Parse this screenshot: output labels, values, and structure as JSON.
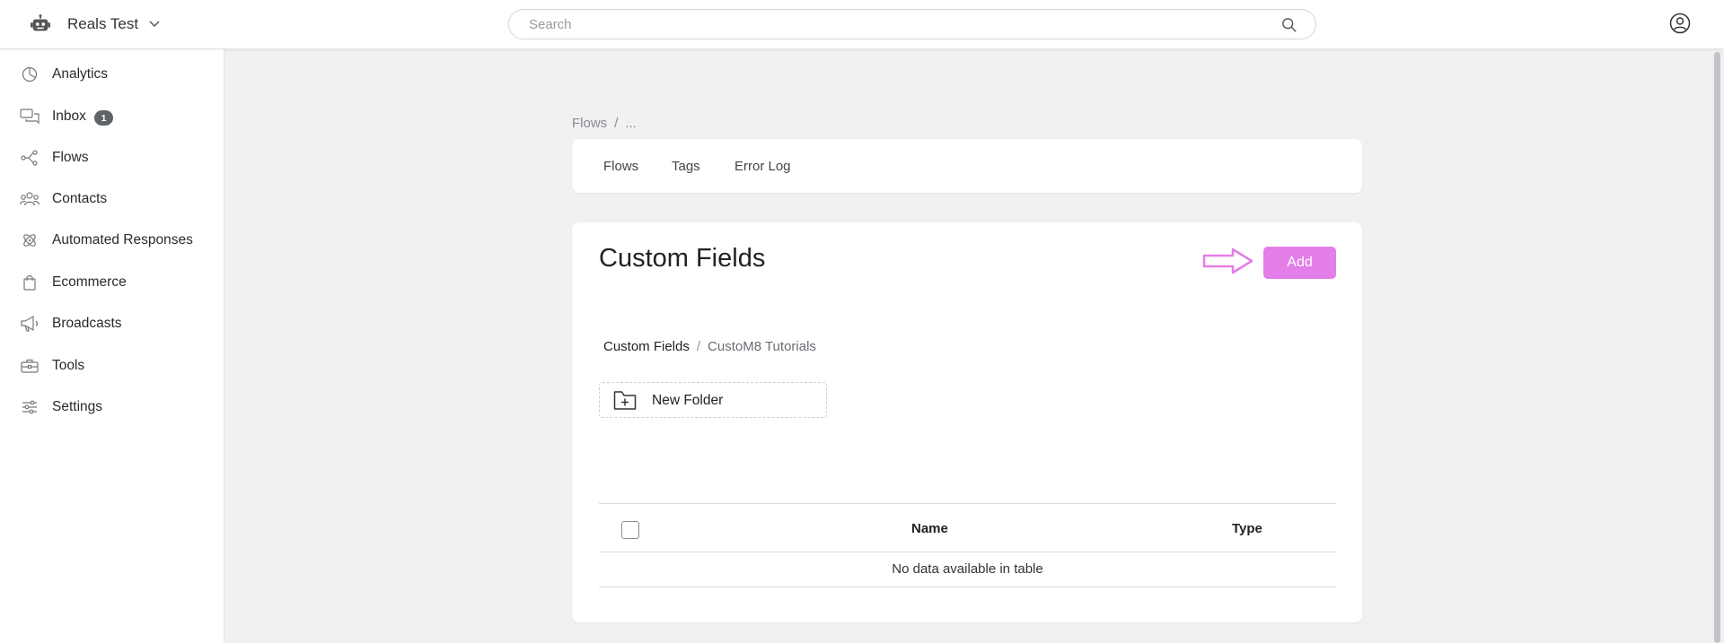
{
  "header": {
    "workspace_name": "Reals Test",
    "search_placeholder": "Search"
  },
  "sidebar": {
    "items": [
      {
        "label": "Analytics",
        "icon": "analytics-icon"
      },
      {
        "label": "Inbox",
        "icon": "inbox-icon",
        "badge": "1"
      },
      {
        "label": "Flows",
        "icon": "flows-icon"
      },
      {
        "label": "Contacts",
        "icon": "contacts-icon"
      },
      {
        "label": "Automated Responses",
        "icon": "automated-responses-icon"
      },
      {
        "label": "Ecommerce",
        "icon": "ecommerce-icon"
      },
      {
        "label": "Broadcasts",
        "icon": "broadcasts-icon"
      },
      {
        "label": "Tools",
        "icon": "tools-icon"
      },
      {
        "label": "Settings",
        "icon": "settings-icon"
      }
    ]
  },
  "breadcrumb": {
    "root": "Flows",
    "separator": "/",
    "current": "..."
  },
  "tabs": [
    {
      "label": "Flows"
    },
    {
      "label": "Tags"
    },
    {
      "label": "Error Log"
    }
  ],
  "panel": {
    "title": "Custom Fields",
    "add_label": "Add",
    "accent_color": "#e47ee8"
  },
  "folder_breadcrumb": {
    "root": "Custom Fields",
    "separator": "/",
    "current": "CustoM8 Tutorials"
  },
  "new_folder_label": "New Folder",
  "table": {
    "columns": [
      "Name",
      "Type"
    ],
    "empty_text": "No data available in table"
  }
}
